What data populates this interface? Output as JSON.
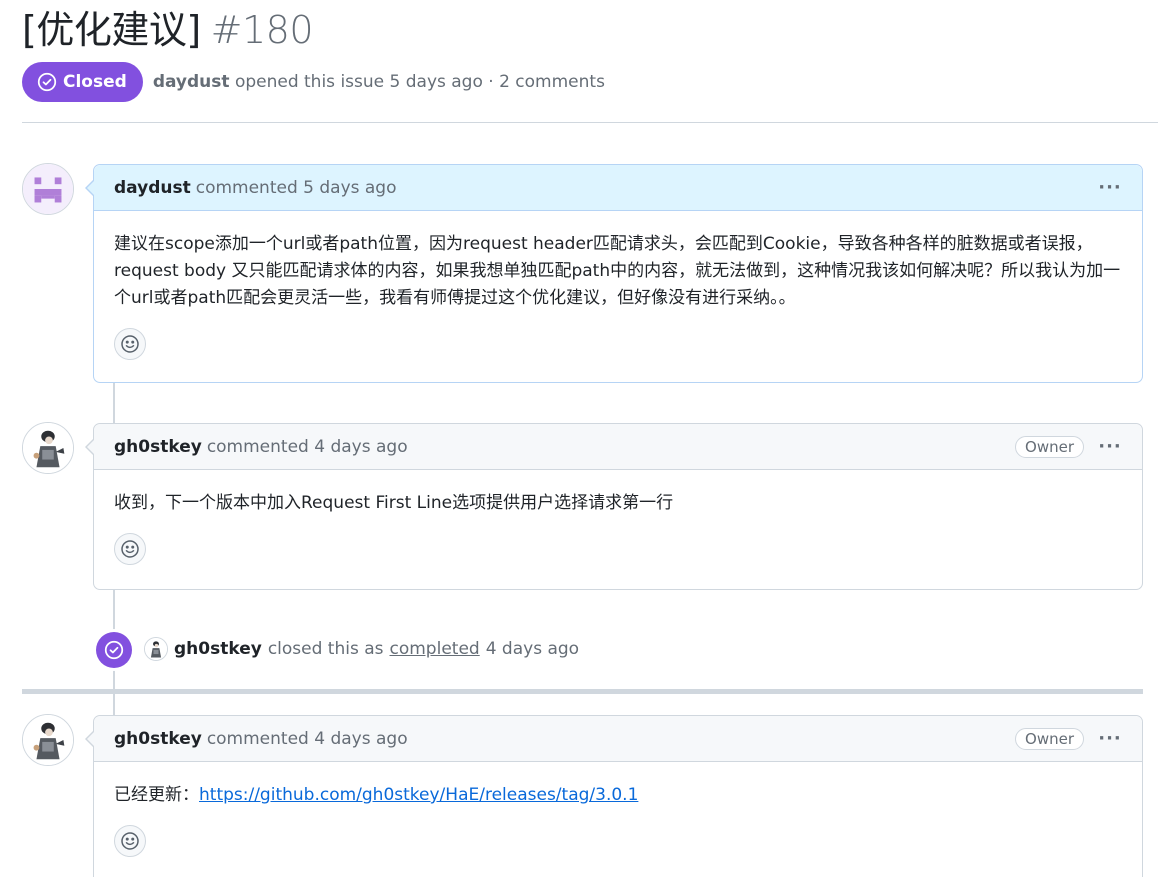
{
  "issue": {
    "title": "[优化建议]",
    "number": "#180",
    "state_label": "Closed",
    "author": "daydust",
    "meta_text": "opened this issue 5 days ago · 2 comments"
  },
  "comments": [
    {
      "author": "daydust",
      "action": "commented 5 days ago",
      "badge": "",
      "body": "建议在scope添加一个url或者path位置，因为request header匹配请求头，会匹配到Cookie，导致各种各样的脏数据或者误报，request body 又只能匹配请求体的内容，如果我想单独匹配path中的内容，就无法做到，这种情况我该如何解决呢？所以我认为加一个url或者path匹配会更灵活一些，我看有师傅提过这个优化建议，但好像没有进行采纳。。",
      "icons": [
        "kebab-icon",
        "smiley-icon"
      ]
    },
    {
      "author": "gh0stkey",
      "action": "commented 4 days ago",
      "badge": "Owner",
      "body": "收到，下一个版本中加入Request First Line选项提供用户选择请求第一行",
      "icons": [
        "kebab-icon",
        "smiley-icon"
      ]
    },
    {
      "author": "gh0stkey",
      "action": "commented 4 days ago",
      "badge": "Owner",
      "body_prefix": "已经更新：",
      "link": "https://github.com/gh0stkey/HaE/releases/tag/3.0.1",
      "icons": [
        "kebab-icon",
        "smiley-icon"
      ]
    }
  ],
  "close_event": {
    "actor": "gh0stkey",
    "text_before": "closed this as",
    "link_text": "completed",
    "text_after": "4 days ago",
    "icon": "check-circle-icon"
  },
  "ui": {
    "kebab": "···"
  },
  "colors": {
    "closed_purple": "#8250df",
    "author_header_bg": "#ddf4ff",
    "author_border": "#b6d4f5",
    "link_blue": "#0969da",
    "muted_text": "#656d76",
    "border": "#d0d7de"
  }
}
